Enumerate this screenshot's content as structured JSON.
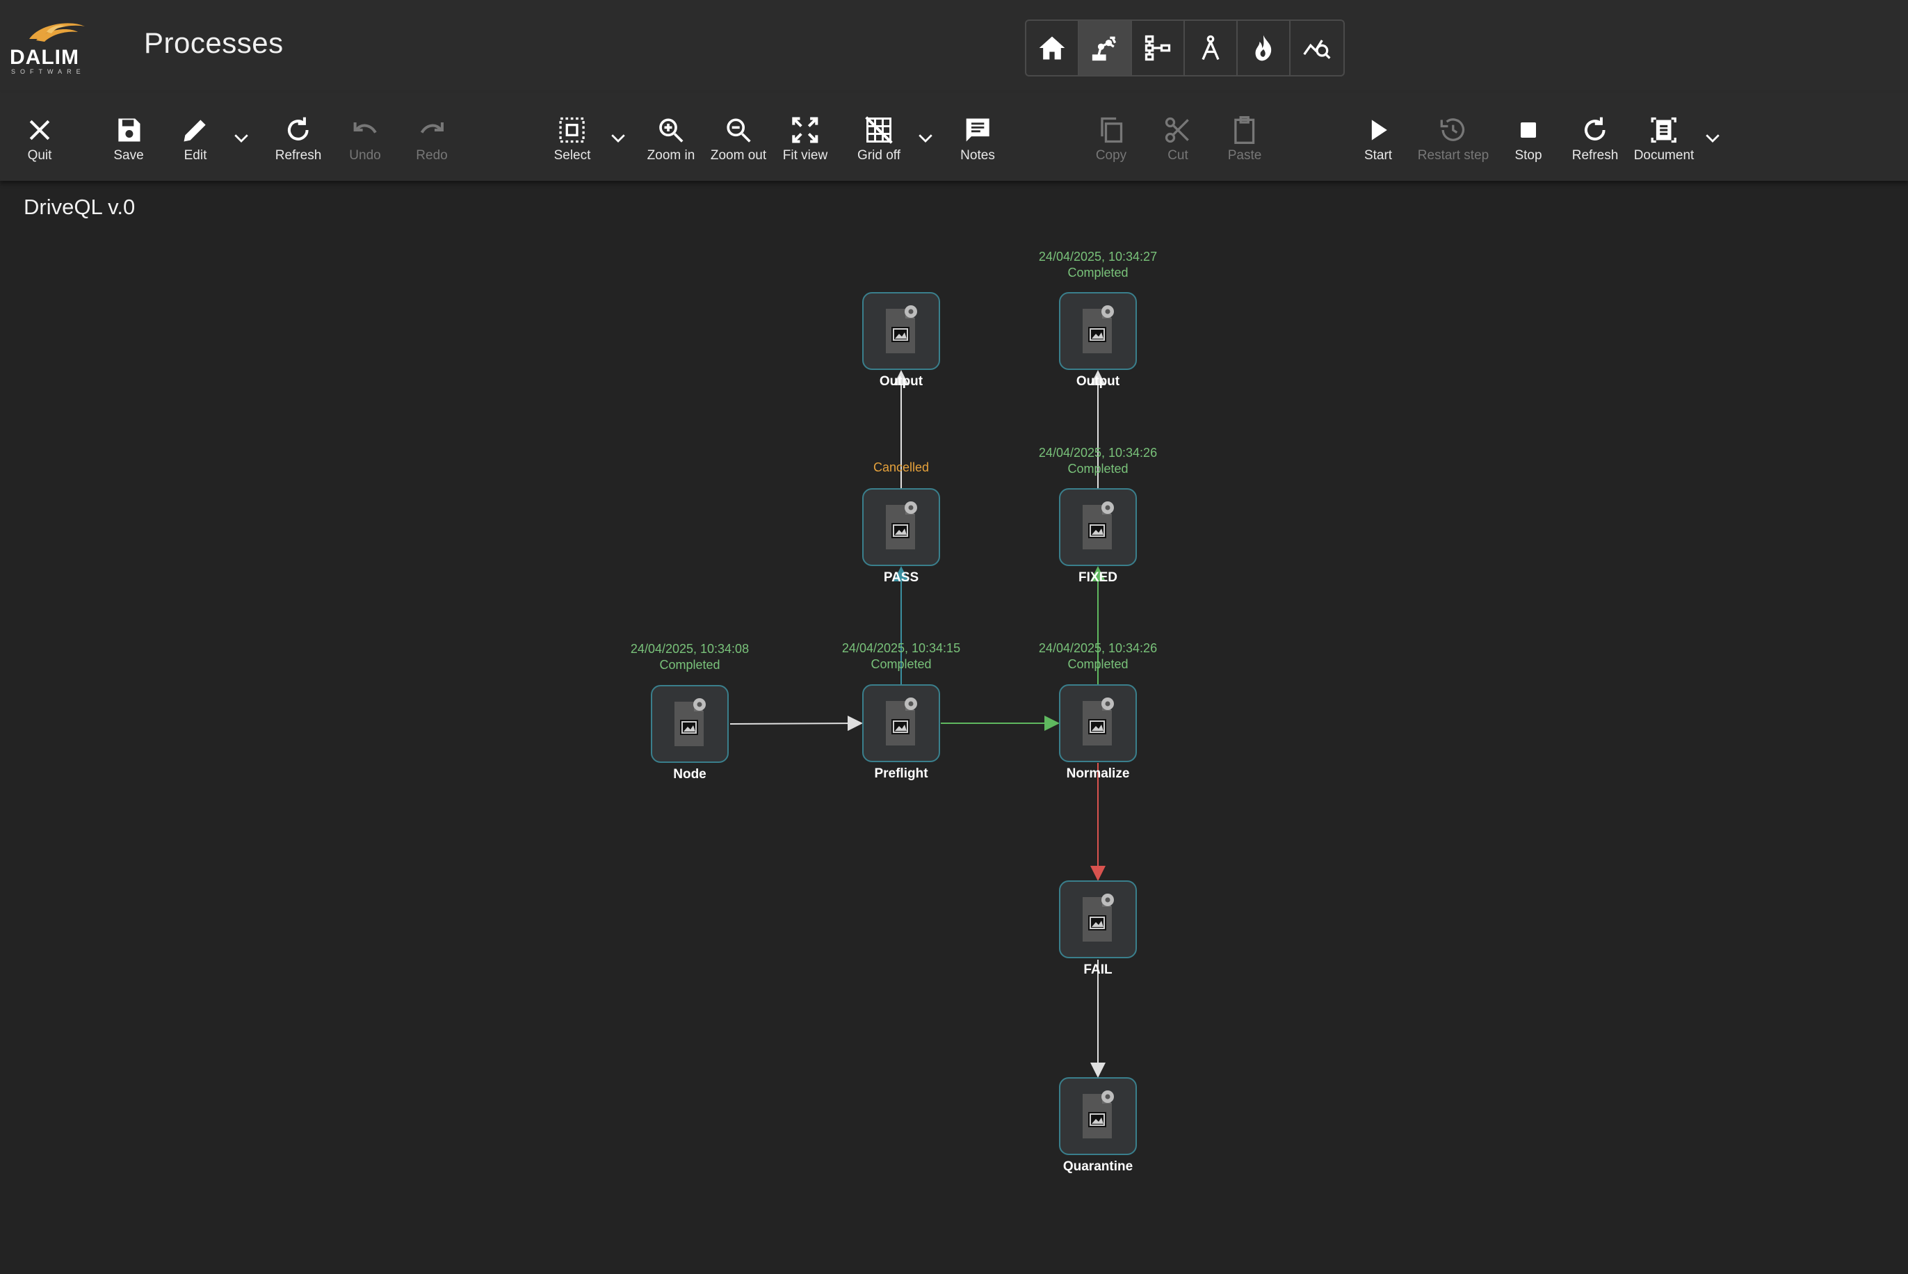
{
  "header": {
    "logo_text": "DALIM",
    "logo_subtext": "SOFTWARE",
    "title": "Processes",
    "nav": [
      {
        "icon": "home-icon",
        "active": false
      },
      {
        "icon": "robot-arm-icon",
        "active": true
      },
      {
        "icon": "hierarchy-icon",
        "active": false
      },
      {
        "icon": "compass-icon",
        "active": false
      },
      {
        "icon": "flame-icon",
        "active": false
      },
      {
        "icon": "analytics-search-icon",
        "active": false
      }
    ]
  },
  "toolbar": {
    "quit": "Quit",
    "save": "Save",
    "edit": "Edit",
    "refresh": "Refresh",
    "undo": "Undo",
    "redo": "Redo",
    "select": "Select",
    "zoom_in": "Zoom in",
    "zoom_out": "Zoom out",
    "fit_view": "Fit view",
    "grid_off": "Grid off",
    "notes": "Notes",
    "copy": "Copy",
    "cut": "Cut",
    "paste": "Paste",
    "start": "Start",
    "restart_step": "Restart step",
    "stop": "Stop",
    "refresh2": "Refresh",
    "document": "Document"
  },
  "canvas": {
    "process_title": "DriveQL v.0",
    "nodes": {
      "node": {
        "label": "Node",
        "timestamp": "24/04/2025, 10:34:08",
        "status": "Completed"
      },
      "preflight": {
        "label": "Preflight",
        "timestamp": "24/04/2025, 10:34:15",
        "status": "Completed"
      },
      "normalize": {
        "label": "Normalize",
        "timestamp": "24/04/2025, 10:34:26",
        "status": "Completed"
      },
      "pass": {
        "label": "PASS",
        "status": "Cancelled"
      },
      "fixed": {
        "label": "FIXED",
        "timestamp": "24/04/2025, 10:34:26",
        "status": "Completed"
      },
      "output1": {
        "label": "Output"
      },
      "output2": {
        "label": "Output",
        "timestamp": "24/04/2025, 10:34:27",
        "status": "Completed"
      },
      "fail": {
        "label": "FAIL"
      },
      "quarantine": {
        "label": "Quarantine"
      }
    }
  },
  "colors": {
    "background": "#232323",
    "bar": "#2c2c2c",
    "node_border": "#3a7f8c",
    "completed": "#79c27a",
    "cancelled": "#e6a23c",
    "edge_default": "#e0e0e0",
    "edge_success": "#5fb85f",
    "edge_fail": "#d9534f",
    "edge_pass": "#3a8fa0"
  }
}
